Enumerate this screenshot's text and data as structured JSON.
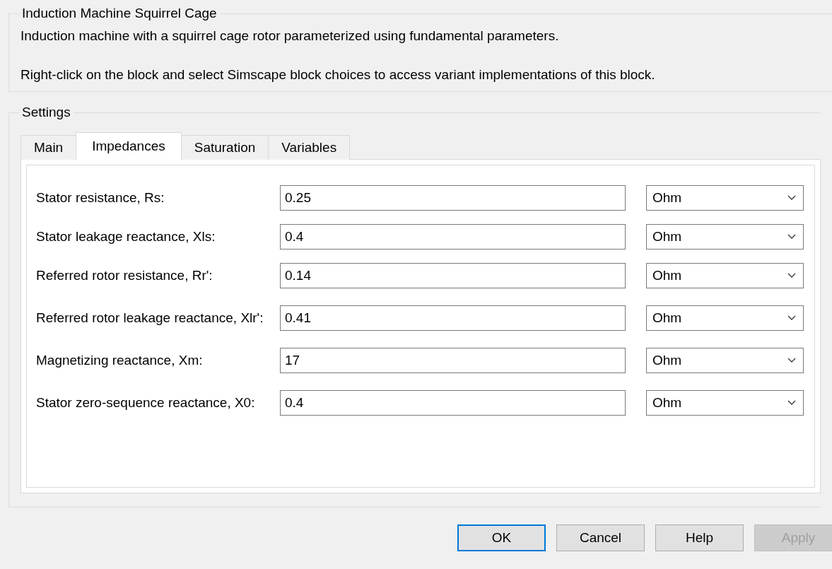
{
  "block": {
    "title": "Induction Machine Squirrel Cage",
    "description": [
      "Induction machine with a squirrel cage rotor parameterized using fundamental parameters.",
      "Right-click on the block and select Simscape block choices to access variant implementations of this block."
    ]
  },
  "settings": {
    "title": "Settings",
    "tabs": [
      {
        "label": "Main",
        "selected": false
      },
      {
        "label": "Impedances",
        "selected": true
      },
      {
        "label": "Saturation",
        "selected": false
      },
      {
        "label": "Variables",
        "selected": false
      }
    ],
    "parameters": [
      {
        "label": "Stator resistance, Rs:",
        "value": "0.25",
        "unit": "Ohm"
      },
      {
        "label": "Stator leakage reactance, Xls:",
        "value": "0.4",
        "unit": "Ohm"
      },
      {
        "label": "Referred rotor resistance, Rr':",
        "value": "0.14",
        "unit": "Ohm"
      },
      {
        "label": "Referred rotor leakage reactance, Xlr':",
        "value": "0.41",
        "unit": "Ohm"
      },
      {
        "label": "Magnetizing reactance, Xm:",
        "value": "17",
        "unit": "Ohm"
      },
      {
        "label": "Stator zero-sequence reactance, X0:",
        "value": "0.4",
        "unit": "Ohm"
      }
    ]
  },
  "buttons": [
    {
      "label": "OK",
      "default": true,
      "disabled": false
    },
    {
      "label": "Cancel",
      "default": false,
      "disabled": false
    },
    {
      "label": "Help",
      "default": false,
      "disabled": false
    },
    {
      "label": "Apply",
      "default": false,
      "disabled": true
    }
  ]
}
